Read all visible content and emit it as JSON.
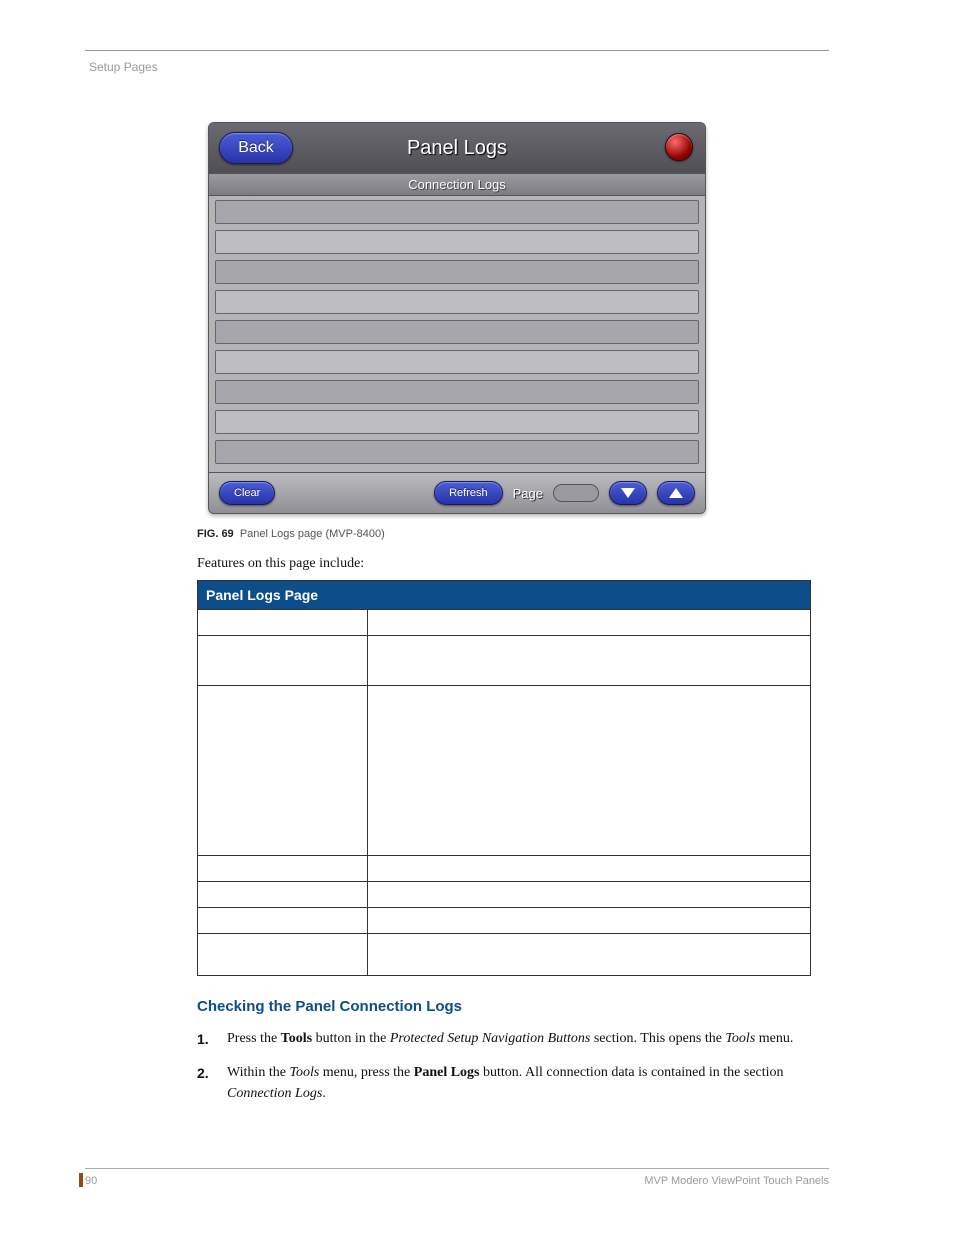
{
  "section_header": "Setup Pages",
  "panel": {
    "back_label": "Back",
    "title": "Panel Logs",
    "subhead": "Connection Logs",
    "clear_label": "Clear",
    "refresh_label": "Refresh",
    "page_label": "Page"
  },
  "figure": {
    "num": "FIG. 69",
    "caption": "Panel Logs page (MVP-8400)"
  },
  "intro": "Features on this page include:",
  "table_title": "Panel Logs Page",
  "subheading": "Checking the Panel Connection Logs",
  "steps": {
    "s1": {
      "n": "1.",
      "pre": "Press the ",
      "b1": "Tools",
      "mid1": " button in the ",
      "i1": "Protected Setup Navigation Buttons",
      "mid2": " section. This opens the ",
      "i2": "Tools",
      "post": " menu."
    },
    "s2": {
      "n": "2.",
      "pre": "Within the ",
      "i1": "Tools",
      "mid1": " menu, press the ",
      "b1": "Panel Logs",
      "mid2": " button. All connection data is contained in the section ",
      "i2": "Connection Logs",
      "post": "."
    }
  },
  "footer": {
    "page_number": "90",
    "doc_title": "MVP Modero ViewPoint Touch Panels"
  }
}
